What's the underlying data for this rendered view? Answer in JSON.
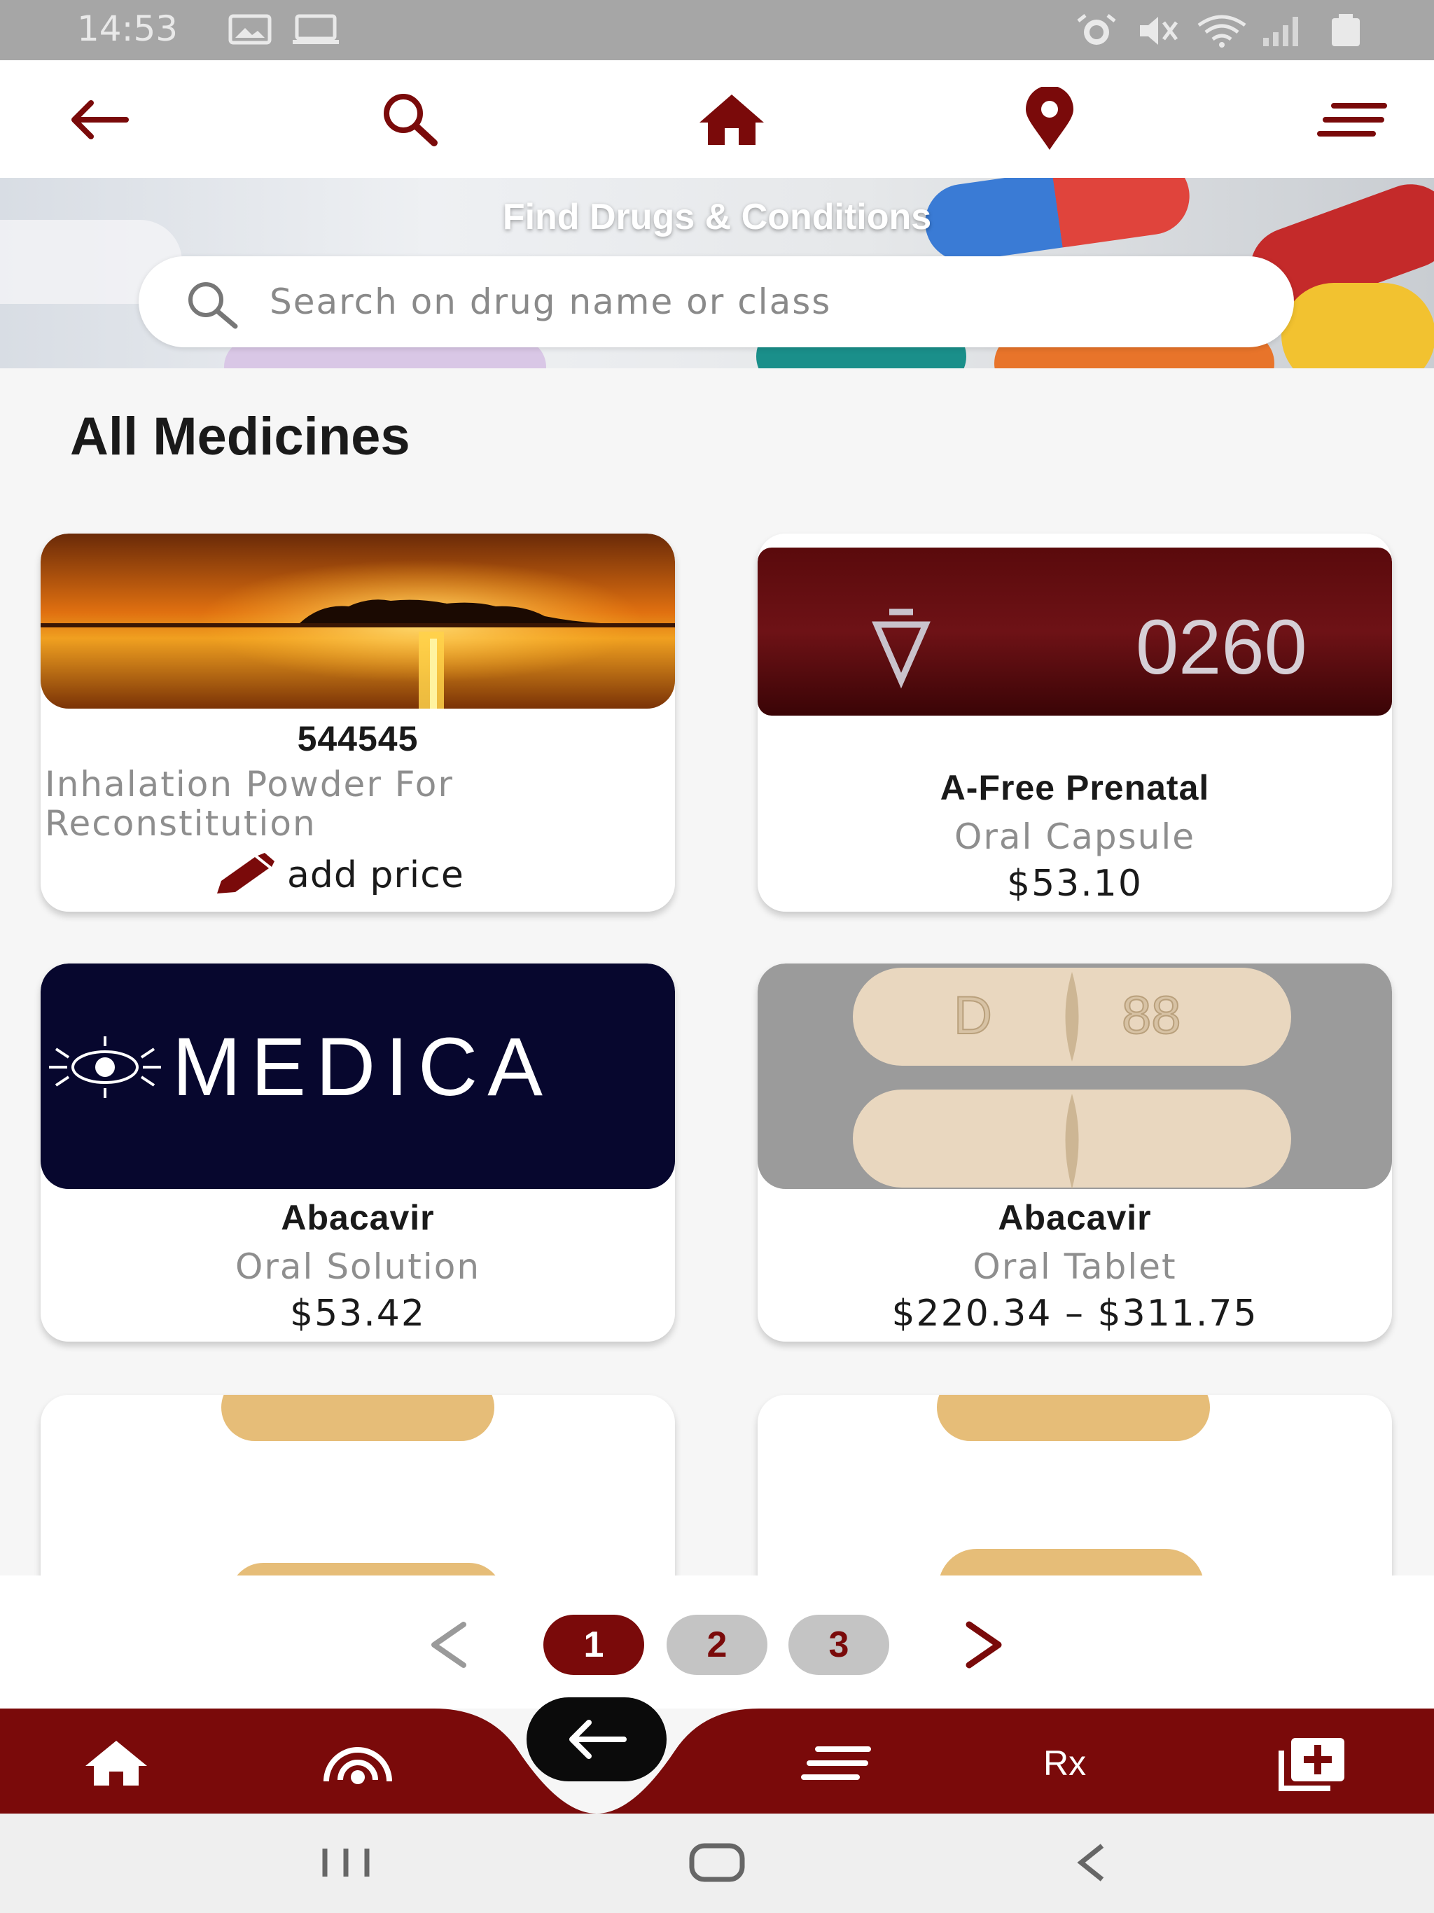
{
  "status_bar": {
    "time": "14:53"
  },
  "top_nav": {
    "icons": [
      "back-arrow-icon",
      "search-icon",
      "home-icon",
      "location-pin-icon",
      "menu-lines-icon"
    ]
  },
  "banner": {
    "title": "Find Drugs & Conditions",
    "search_placeholder": "Search on drug name or class"
  },
  "section_title": "All Medicines",
  "medicines": [
    {
      "name": "544545",
      "form": "Inhalation Powder For Reconstitution",
      "action": "add price",
      "image": "sunset-lake"
    },
    {
      "name": "A-Free Prenatal",
      "form": "Oral Capsule",
      "price": "$53.10",
      "image": "capsule-0260"
    },
    {
      "name": "Abacavir",
      "form": "Oral Solution",
      "price": "$53.42",
      "image": "medica-logo",
      "image_text": "MEDICA"
    },
    {
      "name": "Abacavir",
      "form": "Oral Tablet",
      "price": "$220.34 – $311.75",
      "image": "tablet-d88"
    }
  ],
  "pagination": {
    "pages": [
      "1",
      "2",
      "3"
    ],
    "current": "1"
  },
  "bottom_bar": {
    "rx_label": "Rx"
  },
  "colors": {
    "brand": "#7a0a0a",
    "page_inactive": "#c4c4c4"
  }
}
